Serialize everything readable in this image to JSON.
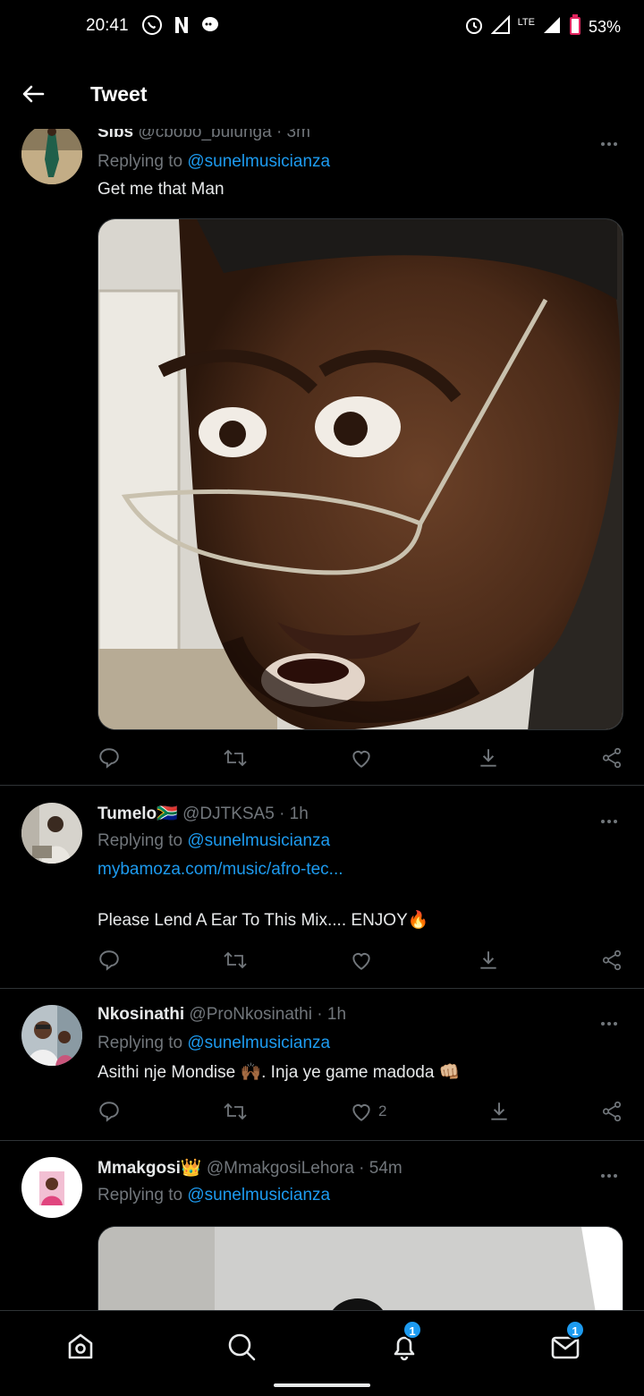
{
  "status_bar": {
    "time": "20:41",
    "network": "LTE",
    "battery": "53%",
    "icons": [
      "whatsapp-icon",
      "netflix-icon",
      "messenger-icon",
      "alarm-icon",
      "signal-icon",
      "battery-icon"
    ]
  },
  "header": {
    "title": "Tweet",
    "back_icon": "arrow-left-icon"
  },
  "tweets": [
    {
      "name": "Sibs",
      "handle": "@cbobo_bulunga",
      "time": "· 3m",
      "replying_prefix": "Replying to ",
      "replying_to": "@sunelmusicianza",
      "text": "Get me that Man",
      "has_media": true,
      "likes": ""
    },
    {
      "name": "Tumelo🇿🇦",
      "handle": "@DJTKSA5",
      "time": "· 1h",
      "replying_prefix": "Replying to ",
      "replying_to": "@sunelmusicianza",
      "link": "mybamoza.com/music/afro-tec...",
      "text": "Please Lend A Ear To This Mix.... ENJOY🔥",
      "likes": ""
    },
    {
      "name": "Nkosinathi",
      "handle": "@ProNkosinathi",
      "time": "· 1h",
      "replying_prefix": "Replying to ",
      "replying_to": "@sunelmusicianza",
      "text": "Asithi nje Mondise 🙌🏾. Inja ye game madoda 👊🏼",
      "likes": "2"
    },
    {
      "name": "Mmakgosi👑",
      "handle": "@MmakgosiLehora",
      "time": "· 54m",
      "replying_prefix": "Replying to ",
      "replying_to": "@sunelmusicianza",
      "has_media": true
    }
  ],
  "bottom_nav": {
    "items": [
      "home-icon",
      "search-icon",
      "notifications-icon",
      "messages-icon"
    ],
    "notifications_badge": "1",
    "messages_badge": "1"
  },
  "colors": {
    "accent": "#1d9bf0",
    "muted": "#71767b",
    "divider": "#2f3336",
    "background": "#000000"
  }
}
